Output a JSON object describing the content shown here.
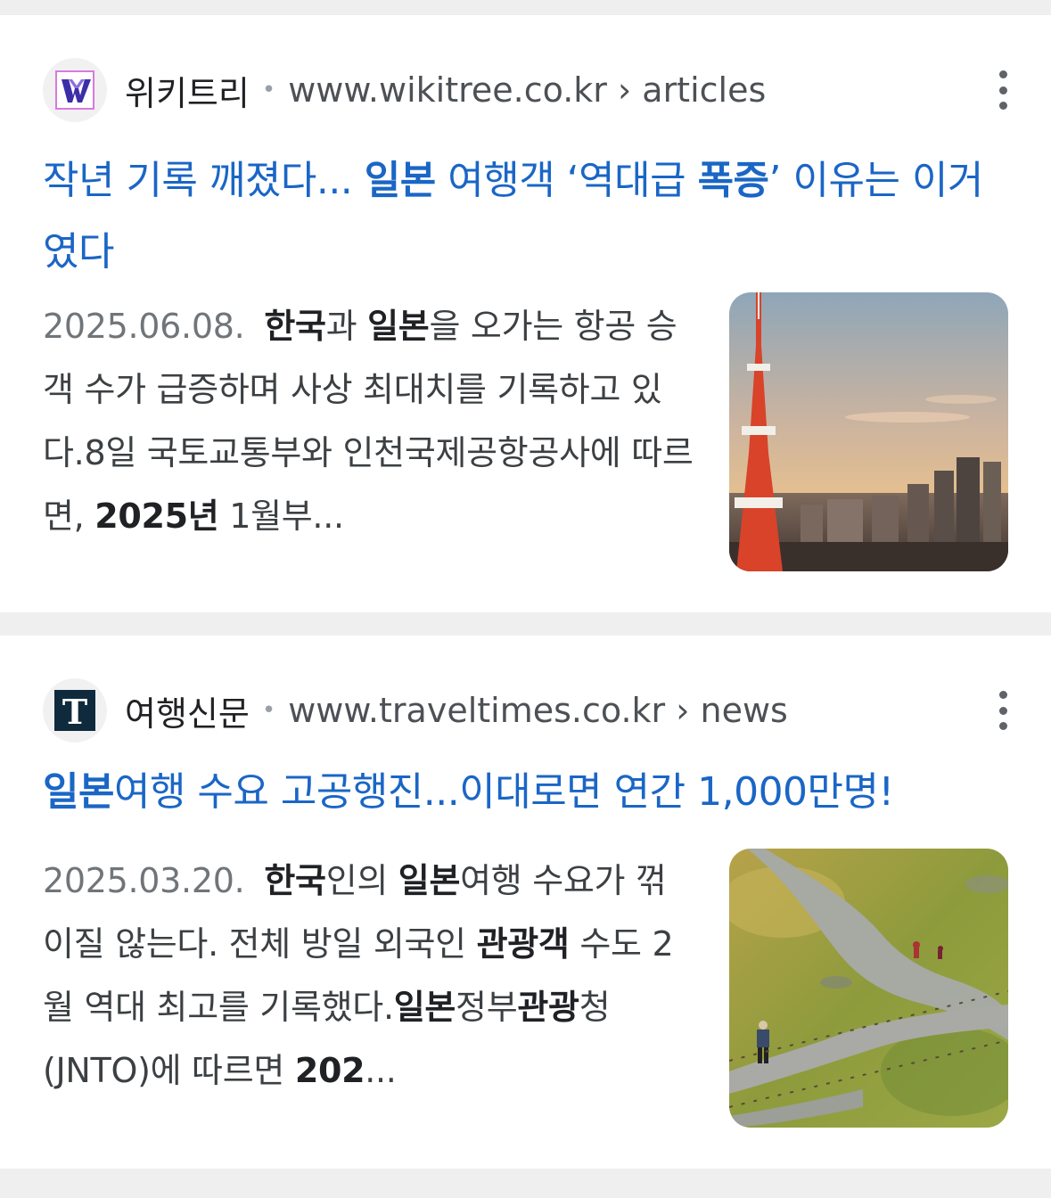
{
  "results": [
    {
      "site_name": "위키트리",
      "site_icon": "wikitree-logo-icon",
      "separator": "•",
      "url": "www.wikitree.co.kr › articles",
      "title_parts": [
        {
          "text": "작년 기록 깨졌다... ",
          "bold": false
        },
        {
          "text": "일본",
          "bold": true
        },
        {
          "text": " 여행객 ‘역대급 ",
          "bold": false
        },
        {
          "text": "폭증",
          "bold": true
        },
        {
          "text": "’ 이유는 이거였다",
          "bold": false
        }
      ],
      "date": "2025.06.08.",
      "snippet_parts": [
        {
          "text": "한국",
          "bold": true
        },
        {
          "text": "과 ",
          "bold": false
        },
        {
          "text": "일본",
          "bold": true
        },
        {
          "text": "을 오가는 항공 승객 수가 급증하며 사상 최대치를 기록하고 있다.8일 국토교통부와 인천국제공항공사에 따르면, ",
          "bold": false
        },
        {
          "text": "2025년",
          "bold": true
        },
        {
          "text": " 1월부...",
          "bold": false
        }
      ],
      "thumbnail": "tokyo-tower-skyline-image"
    },
    {
      "site_name": "여행신문",
      "site_icon": "traveltimes-logo-icon",
      "separator": "•",
      "url": "www.traveltimes.co.kr › news",
      "title_parts": [
        {
          "text": "일본",
          "bold": true
        },
        {
          "text": "여행 수요 고공행진...이대로면 연간 1,000만명!",
          "bold": false
        }
      ],
      "date": "2025.03.20.",
      "snippet_parts": [
        {
          "text": "한국",
          "bold": true
        },
        {
          "text": "인의 ",
          "bold": false
        },
        {
          "text": "일본",
          "bold": true
        },
        {
          "text": "여행 수요가 꺾이질 않는다. 전체 방일 외국인 ",
          "bold": false
        },
        {
          "text": "관광객",
          "bold": true
        },
        {
          "text": " 수도 2월 역대 최고를 기록했다.",
          "bold": false
        },
        {
          "text": "일본",
          "bold": true
        },
        {
          "text": "정부",
          "bold": false
        },
        {
          "text": "관광",
          "bold": true
        },
        {
          "text": "청(JNTO)에 따르면 ",
          "bold": false
        },
        {
          "text": "202",
          "bold": true
        },
        {
          "text": "...",
          "bold": false
        }
      ],
      "thumbnail": "mountain-hiking-trail-image"
    }
  ],
  "colors": {
    "title_link": "#1a66c6",
    "background": "#efefef",
    "card": "#ffffff"
  }
}
